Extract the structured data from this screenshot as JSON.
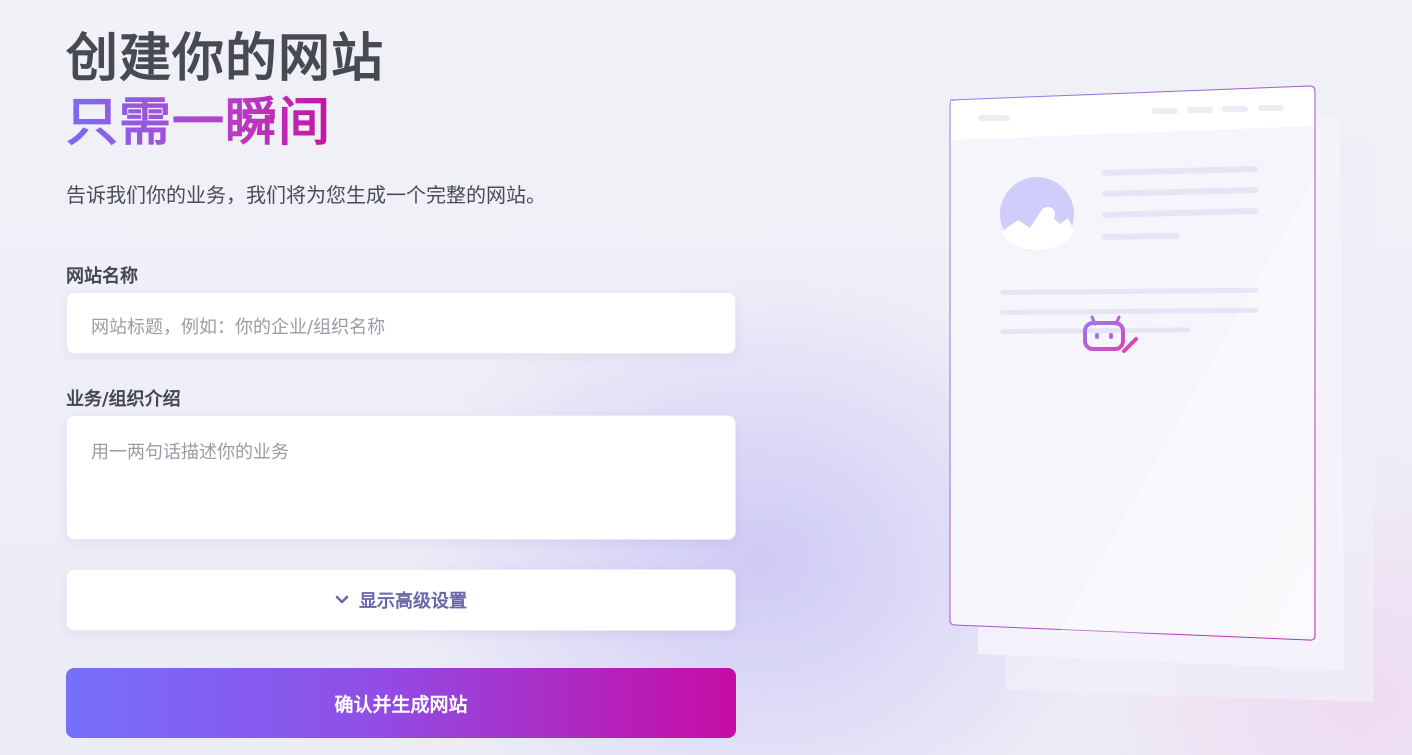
{
  "hero": {
    "title_line1": "创建你的网站",
    "title_line2": "只需一瞬间",
    "subtitle": "告诉我们你的业务，我们将为您生成一个完整的网站。"
  },
  "form": {
    "site_name": {
      "label": "网站名称",
      "value": "",
      "placeholder": "网站标题，例如：你的企业/组织名称"
    },
    "description": {
      "label": "业务/组织介绍",
      "value": "",
      "placeholder": "用一两句话描述你的业务"
    },
    "advanced_toggle_label": "显示高级设置",
    "submit_label": "确认并生成网站"
  },
  "icons": {
    "advanced_toggle": "chevron-down-icon",
    "illustration_image": "image-placeholder-icon",
    "illustration_bot": "robot-pen-icon"
  },
  "colors": {
    "accent_start": "#7670fb",
    "accent_end": "#c60ca5",
    "title_text": "#474a52",
    "advanced_text": "#6a66a8"
  }
}
